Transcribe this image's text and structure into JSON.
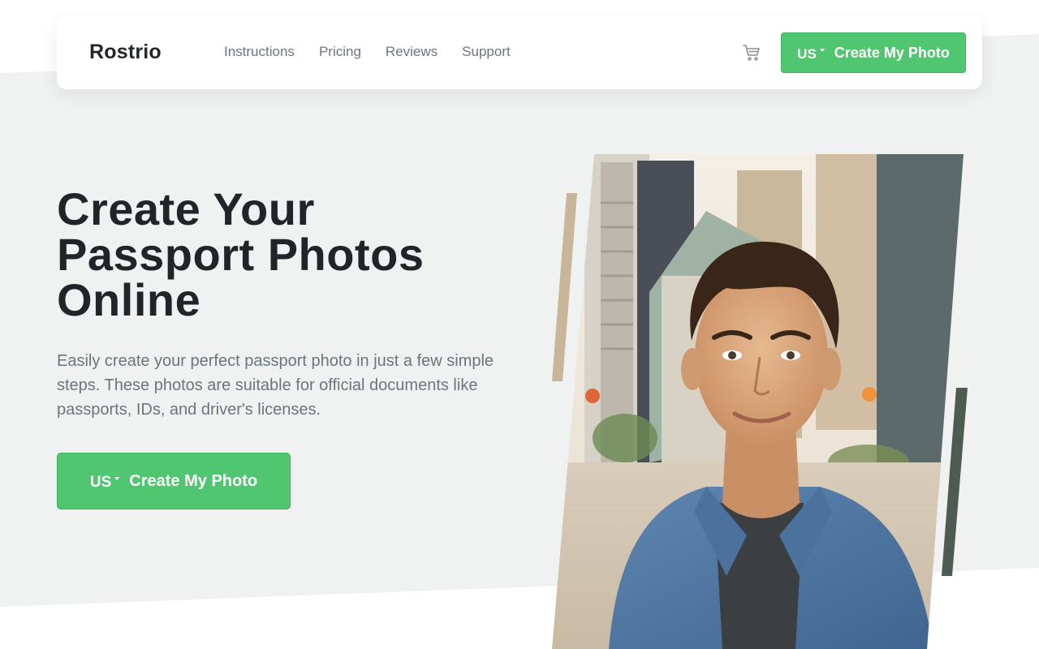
{
  "colors": {
    "accent": "#4fc66f",
    "hero_background": "#f0f2f1",
    "heading": "#212529",
    "muted_text": "#6c757d"
  },
  "navbar": {
    "brand": "Rostrio",
    "links": [
      {
        "label": "Instructions"
      },
      {
        "label": "Pricing"
      },
      {
        "label": "Reviews"
      },
      {
        "label": "Support"
      }
    ],
    "cart_icon": "shopping-cart-icon",
    "cta": {
      "country": "US",
      "label": "Create My Photo"
    }
  },
  "hero": {
    "title_lines": [
      "Create Your",
      "Passport Photos",
      "Online"
    ],
    "description": "Easily create your perfect passport photo in just a few simple steps. These photos are suitable for official documents like passports, IDs, and driver's licenses.",
    "cta": {
      "country": "US",
      "label": "Create My Photo"
    },
    "image": "portrait-photo-young-man-city-street"
  }
}
